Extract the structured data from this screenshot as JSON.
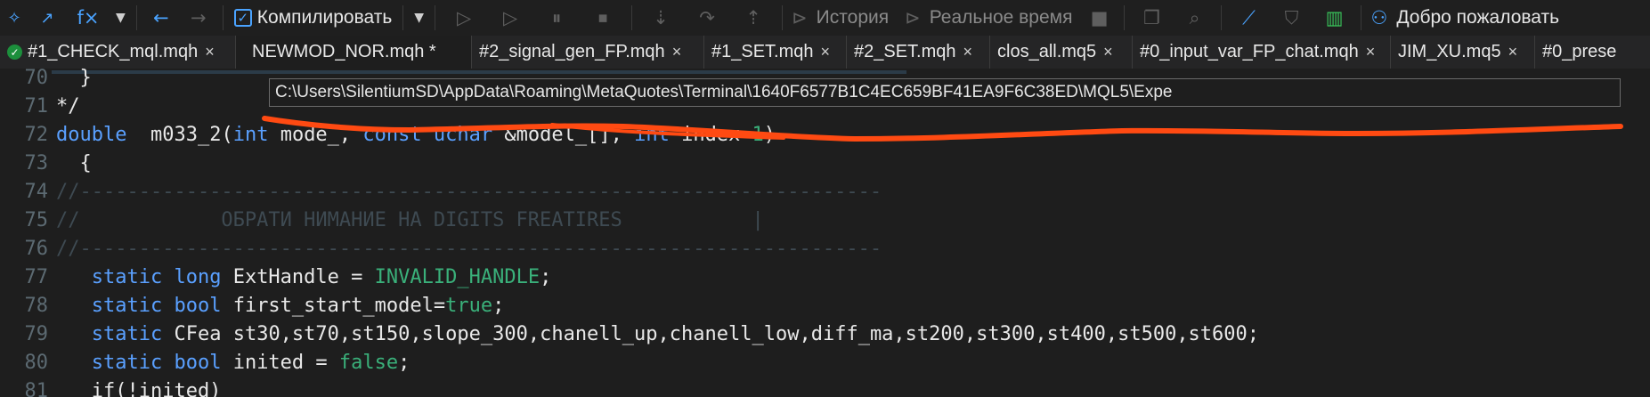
{
  "toolbar": {
    "formula_label": "f×",
    "compile_label": "Компилировать",
    "history_label": "История",
    "realtime_label": "Реальное время",
    "welcome_label": "Добро пожаловать"
  },
  "tabs": [
    {
      "label": "#1_CHECK_mql.mqh",
      "modified_icon": true,
      "active": false
    },
    {
      "label": "NEWMOD_NOR.mqh *",
      "modified_icon": false,
      "active": true
    },
    {
      "label": "#2_signal_gen_FP.mqh",
      "modified_icon": false,
      "active": false
    },
    {
      "label": "#1_SET.mqh",
      "modified_icon": false,
      "active": false
    },
    {
      "label": "#2_SET.mqh",
      "modified_icon": false,
      "active": false
    },
    {
      "label": "clos_all.mq5",
      "modified_icon": false,
      "active": false
    },
    {
      "label": "#0_input_var_FP_chat.mqh",
      "modified_icon": false,
      "active": false
    },
    {
      "label": "JIM_XU.mq5",
      "modified_icon": false,
      "active": false
    },
    {
      "label": "#0_prese",
      "modified_icon": false,
      "active": false
    }
  ],
  "tab_close_glyph": "×",
  "tooltip": {
    "path": "C:\\Users\\SilentiumSD\\AppData\\Roaming\\MetaQuotes\\Terminal\\1640F6577B1C4EC659BF41EA9F6C38ED\\MQL5\\Expe"
  },
  "editor": {
    "lines": [
      {
        "n": "70",
        "text": "  }"
      },
      {
        "n": "71",
        "text": "*/"
      },
      {
        "n": "72",
        "parts": [
          [
            "kw",
            "double"
          ],
          [
            "",
            "  m033_2("
          ],
          [
            "kw",
            "int"
          ],
          [
            "",
            " mode_, "
          ],
          [
            "kw",
            "const uchar"
          ],
          [
            "",
            " &model_[], "
          ],
          [
            "kw",
            "int"
          ],
          [
            "",
            " index="
          ],
          [
            "grn",
            "1"
          ],
          [
            "",
            ")"
          ]
        ]
      },
      {
        "n": "73",
        "text": "  {"
      },
      {
        "n": "74",
        "comment": "//--------------------------------------------------------------------"
      },
      {
        "n": "75",
        "comment": "//            ОБРАТИ НИМАНИЕ НА DIGITS FREATIRES           |"
      },
      {
        "n": "76",
        "comment": "//--------------------------------------------------------------------"
      },
      {
        "n": "77",
        "parts": [
          [
            "",
            "   "
          ],
          [
            "kw",
            "static long"
          ],
          [
            "",
            " ExtHandle = "
          ],
          [
            "grn",
            "INVALID_HANDLE"
          ],
          [
            "",
            ";"
          ]
        ]
      },
      {
        "n": "78",
        "parts": [
          [
            "",
            "   "
          ],
          [
            "kw",
            "static bool"
          ],
          [
            "",
            " first_start_model="
          ],
          [
            "grn",
            "true"
          ],
          [
            "",
            ";"
          ]
        ]
      },
      {
        "n": "79",
        "parts": [
          [
            "",
            "   "
          ],
          [
            "kw",
            "static"
          ],
          [
            "",
            " CFea st30,st70,st150,slope_300,chanell_up,chanell_low,diff_ma,st200,st300,st400,st500,st600;"
          ]
        ]
      },
      {
        "n": "80",
        "parts": [
          [
            "",
            "   "
          ],
          [
            "kw",
            "static bool"
          ],
          [
            "",
            " inited = "
          ],
          [
            "grn",
            "false"
          ],
          [
            "",
            ";"
          ]
        ]
      },
      {
        "n": "81",
        "text": "   if(!inited)"
      }
    ]
  },
  "colors": {
    "keyword": "#5aa0ff",
    "literal": "#3ab07a",
    "comment": "#3e4a52",
    "annotation_stroke": "#ff4a12",
    "modified_badge": "#1c8f3c"
  }
}
